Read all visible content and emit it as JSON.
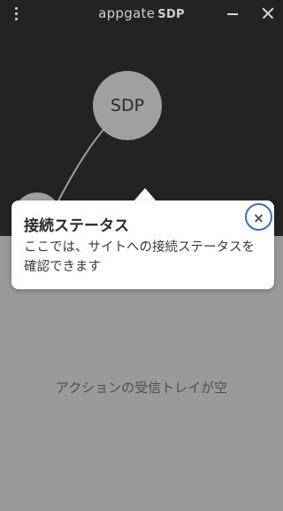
{
  "titlebar": {
    "app_name": "appgate",
    "app_suffix": "SDP",
    "menu_icon": "kebab-menu-icon",
    "minimize_icon": "minimize-icon",
    "close_icon": "close-icon"
  },
  "topology": {
    "node_label": "SDP",
    "background": "#232323",
    "node_color": "#a0a0a0"
  },
  "tooltip": {
    "title": "接続ステータス",
    "body": "ここでは、サイトへの接続ステータスを確認できます",
    "close_icon": "close-icon",
    "close_ring_color": "#3f6fb7"
  },
  "inbox": {
    "empty_message": "アクションの受信トレイが空"
  }
}
